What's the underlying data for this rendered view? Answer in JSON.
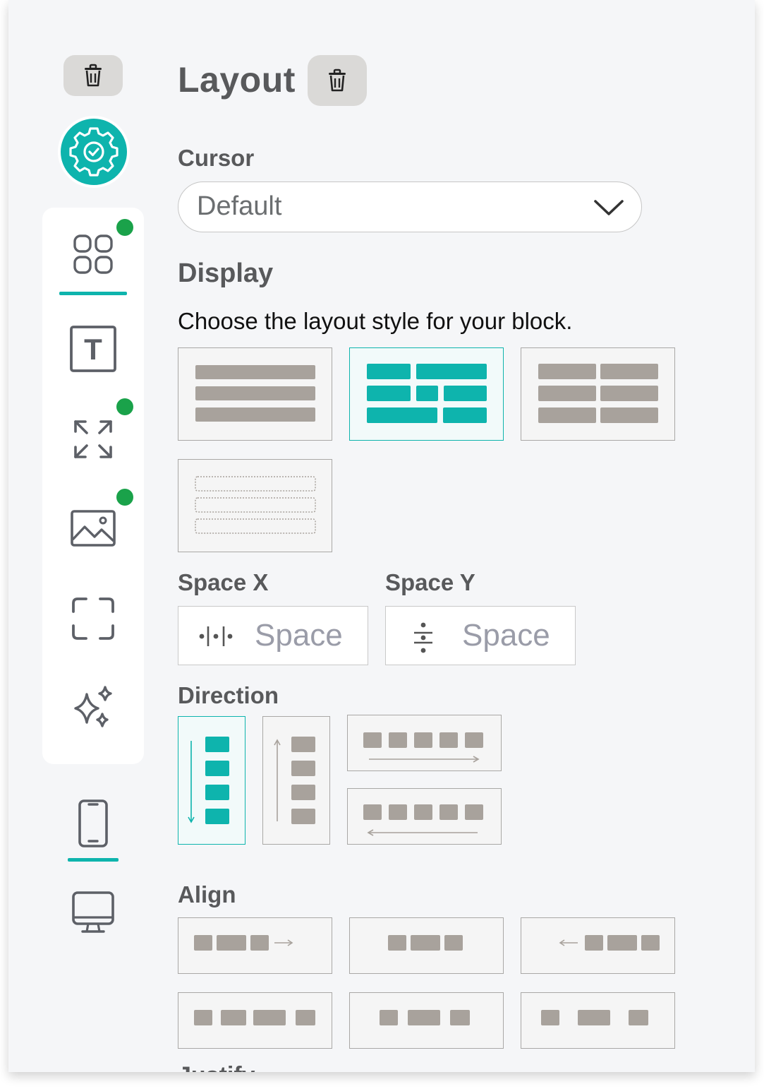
{
  "colors": {
    "accent": "#0eb4ad",
    "tile_fill": "#a8a29c",
    "status_dot": "#1aa24a"
  },
  "rail": {
    "top_delete_icon": "trash-icon",
    "settings_icon": "gear-check-icon",
    "items": [
      {
        "icon": "grid-layout-icon",
        "active": true,
        "has_dot": true
      },
      {
        "icon": "text-t-icon",
        "active": false,
        "has_dot": false
      },
      {
        "icon": "expand-arrows-icon",
        "active": false,
        "has_dot": true
      },
      {
        "icon": "image-icon",
        "active": false,
        "has_dot": true
      },
      {
        "icon": "frame-corners-icon",
        "active": false,
        "has_dot": false
      },
      {
        "icon": "sparkles-icon",
        "active": false,
        "has_dot": false
      }
    ],
    "devices": [
      {
        "icon": "mobile-phone-icon",
        "active": true
      },
      {
        "icon": "desktop-monitor-icon",
        "active": false
      }
    ]
  },
  "header": {
    "title": "Layout",
    "delete_icon": "trash-icon"
  },
  "cursor": {
    "label": "Cursor",
    "value": "Default"
  },
  "display": {
    "heading": "Display",
    "description": "Choose the layout style for your block.",
    "options": [
      "stacked-rows",
      "grid",
      "split-columns",
      "outlined-rows"
    ],
    "selected": "grid"
  },
  "space_x": {
    "label": "Space X",
    "placeholder": "Space"
  },
  "space_y": {
    "label": "Space Y",
    "placeholder": "Space"
  },
  "direction": {
    "heading": "Direction",
    "options": [
      "column",
      "column-reverse",
      "row",
      "row-reverse"
    ],
    "selected": "column"
  },
  "align": {
    "heading": "Align",
    "options": [
      "start",
      "center",
      "end",
      "space-between",
      "space-around",
      "space-evenly"
    ]
  },
  "next_section_partial": "Justify"
}
